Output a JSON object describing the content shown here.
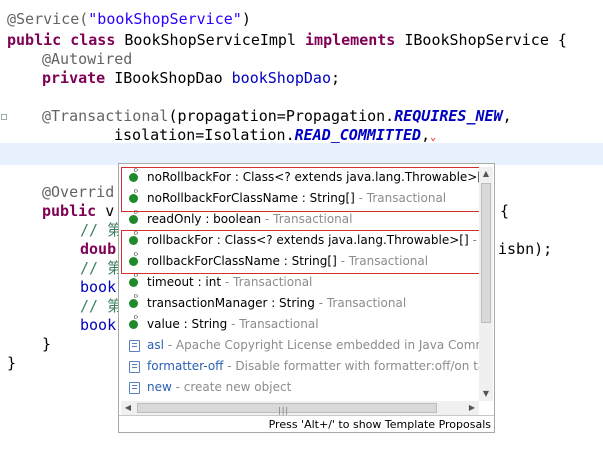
{
  "code": {
    "l1": {
      "ann": "@Service(",
      "str": "\"bookShopService\"",
      "end": ")"
    },
    "l2": {
      "kw1": "public",
      "kw2": "class",
      "name": " BookShopServiceImpl ",
      "kw3": "implements",
      "iface": " IBookShopService {"
    },
    "l3": {
      "ann": "@Autowired"
    },
    "l4": {
      "kw": "private",
      "type": " IBookShopDao ",
      "field": "bookShopDao",
      "end": ";"
    },
    "l5": {
      "ann": "@Transactional",
      "a": "(propagation=Propagation.",
      "c": "REQUIRES_NEW",
      "b": ","
    },
    "l6": {
      "a": "isolation=Isolation.",
      "c": "READ_COMMITTED",
      "b": ","
    },
    "l8": {
      "ann": "@Overrid"
    },
    "l9": {
      "kw": "public",
      "rest": " v",
      "tail": "{"
    },
    "l10": {
      "cmt": "// 第"
    },
    "l11": {
      "kw": "doub",
      "tail": "isbn);"
    },
    "l12": {
      "cmt": "// 第"
    },
    "l13": {
      "field": "book"
    },
    "l14": {
      "cmt": "// 第"
    },
    "l15": {
      "field": "book"
    },
    "l16": {
      "b": "}"
    },
    "l17": {
      "b": "}"
    }
  },
  "popup": {
    "items": [
      {
        "name": "noRollbackFor : Class<? extends java.lang.Throwable>[] - ",
        "src": "",
        "icon": "green-circle-icon"
      },
      {
        "name": "noRollbackForClassName : String[]",
        "src": " - Transactional",
        "icon": "green-circle-icon"
      },
      {
        "name": "readOnly : boolean",
        "src": " - Transactional",
        "icon": "green-circle-icon"
      },
      {
        "name": "rollbackFor : Class<? extends java.lang.Throwable>[]",
        "src": " - Tr",
        "icon": "green-circle-icon"
      },
      {
        "name": "rollbackForClassName : String[]",
        "src": " - Transactional",
        "icon": "green-circle-icon"
      },
      {
        "name": "timeout : int",
        "src": " - Transactional",
        "icon": "green-circle-icon"
      },
      {
        "name": "transactionManager : String",
        "src": " - Transactional",
        "icon": "green-circle-icon"
      },
      {
        "name": "value : String",
        "src": " - Transactional",
        "icon": "green-circle-icon"
      },
      {
        "name": "asl",
        "src": " - Apache Copyright License embedded in Java Comme",
        "icon": "template-icon"
      },
      {
        "name": "formatter-off",
        "src": " - Disable formatter with formatter:off/on tag",
        "icon": "template-icon"
      },
      {
        "name": "new",
        "src": " - create new object",
        "icon": "template-icon"
      }
    ],
    "footer": "Press 'Alt+/' to show Template Proposals"
  }
}
